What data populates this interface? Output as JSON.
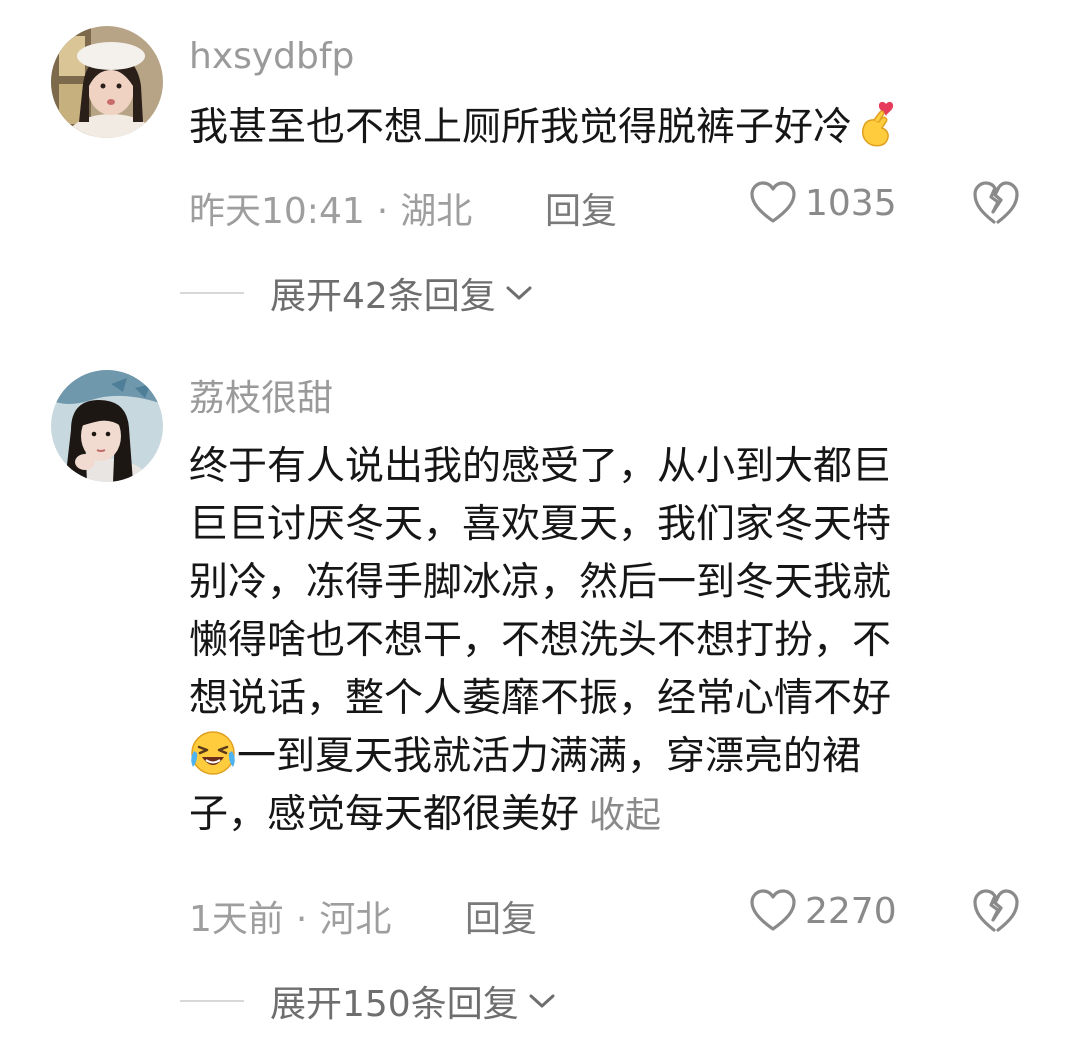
{
  "comments": [
    {
      "username": "hxsydbfp",
      "avatar_icon": "user-avatar-photo",
      "text": "我甚至也不想上厕所我觉得脱裤子好冷",
      "trailing_emoji": "finger-heart-emoji",
      "time": "昨天10:41",
      "location": "湖北",
      "separator": "·",
      "reply_label": "回复",
      "likes": "1035",
      "expand_label": "展开42条回复"
    },
    {
      "username": "荔枝很甜",
      "avatar_icon": "user-avatar-photo",
      "text_lines": [
        "终于有人说出我的感受了，从小到大都巨",
        "巨巨讨厌冬天，喜欢夏天，我们家冬天特",
        "别冷，冻得手脚冰凉，然后一到冬天我就",
        "懒得啥也不想干，不想洗头不想打扮，不",
        "想说话，整个人萎靡不振，经常心情不好",
        "一到夏天我就活力满满，穿漂亮的裙",
        "子，感觉每天都很美好"
      ],
      "inline_emoji": "laughing-crying-emoji",
      "collapse_label": "收起",
      "time": "1天前",
      "location": "河北",
      "separator": "·",
      "reply_label": "回复",
      "likes": "2270",
      "expand_label": "展开150条回复"
    }
  ],
  "icons": {
    "like": "heart-outline-icon",
    "dislike": "broken-heart-icon",
    "expand": "chevron-down-icon"
  },
  "colors": {
    "text_primary": "#161616",
    "text_secondary": "#9e9e9e",
    "link": "#6e6e6e"
  }
}
